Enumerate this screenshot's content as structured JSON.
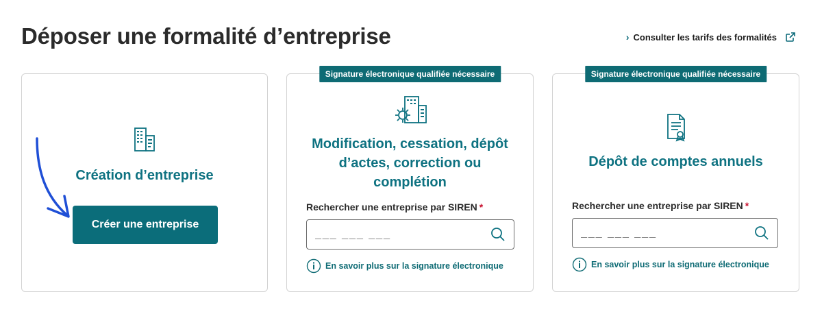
{
  "header": {
    "title": "Déposer une formalité d’entreprise",
    "tarifs_link": "Consulter les tarifs des formalités"
  },
  "cards": [
    {
      "title": "Création d’entreprise",
      "button": "Créer une entreprise",
      "icon": "buildings-document-icon"
    },
    {
      "badge": "Signature électronique qualifiée nécessaire",
      "title": "Modification, cessation, dépôt d’actes, correction ou complétion",
      "search_label": "Rechercher une entreprise par SIREN",
      "required_mark": "*",
      "placeholder": "___ ___ ___",
      "info_link": "En savoir plus sur la signature électronique",
      "icon": "buildings-gear-icon"
    },
    {
      "badge": "Signature électronique qualifiée nécessaire",
      "title": "Dépôt de comptes annuels",
      "search_label": "Rechercher une entreprise par SIREN",
      "required_mark": "*",
      "placeholder": "___ ___ ___",
      "info_link": "En savoir plus sur la signature électronique",
      "icon": "certificate-document-icon"
    }
  ],
  "colors": {
    "accent": "#0e7281",
    "badge": "#0e6b74",
    "button": "#0b6d7a",
    "arrow": "#1f4fd6",
    "required": "#c8102e"
  }
}
